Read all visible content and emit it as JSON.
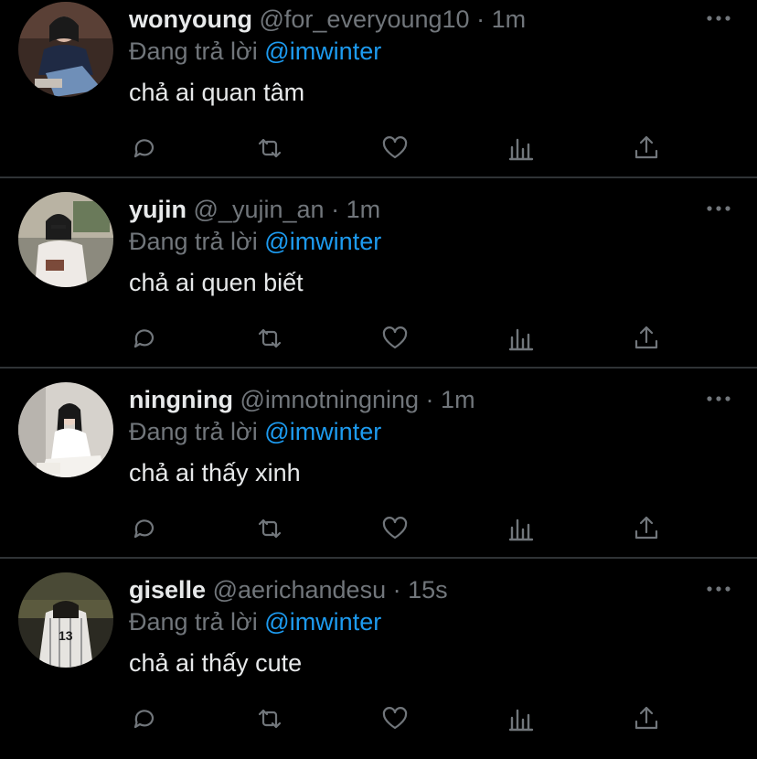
{
  "colors": {
    "background": "#000000",
    "divider": "#2f3336",
    "primary_text": "#e7e9ea",
    "secondary_text": "#71767b",
    "accent": "#1d9bf0"
  },
  "tweets": [
    {
      "name": "wonyoung",
      "handle": "@for_everyoung10",
      "time": "1m",
      "replying_prefix": "Đang trả lời",
      "replying_to": "@imwinter",
      "text": "chả ai quan tâm",
      "avatar_icon": "avatar-photo"
    },
    {
      "name": "yujin",
      "handle": "@_yujin_an",
      "time": "1m",
      "replying_prefix": "Đang trả lời",
      "replying_to": "@imwinter",
      "text": "chả ai quen biết",
      "avatar_icon": "avatar-photo"
    },
    {
      "name": "ningning",
      "handle": "@imnotningning",
      "time": "1m",
      "replying_prefix": "Đang trả lời",
      "replying_to": "@imwinter",
      "text": "chả ai thấy xinh",
      "avatar_icon": "avatar-photo"
    },
    {
      "name": "giselle",
      "handle": "@aerichandesu",
      "time": "15s",
      "replying_prefix": "Đang trả lời",
      "replying_to": "@imwinter",
      "text": "chả ai thấy cute",
      "avatar_icon": "avatar-photo"
    }
  ],
  "separator": "·",
  "action_icons": [
    "reply-icon",
    "retweet-icon",
    "like-icon",
    "analytics-icon",
    "share-icon"
  ]
}
